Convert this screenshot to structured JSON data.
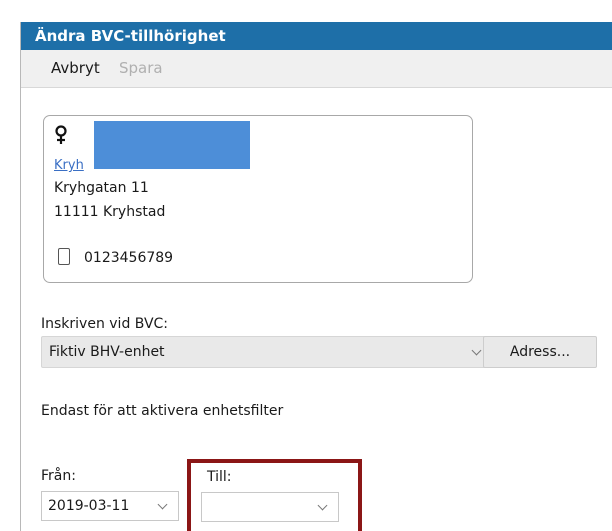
{
  "window": {
    "title": "Ändra BVC-tillhörighet"
  },
  "toolbar": {
    "cancel_label": "Avbryt",
    "save_label": "Spara"
  },
  "patient_card": {
    "link_text": "Kryh",
    "street": "Kryhgatan 11",
    "city": "11111 Kryhstad",
    "phone": "0123456789",
    "gender_icon": "female-icon",
    "phone_icon": "mobile-phone-icon"
  },
  "bvc": {
    "label": "Inskriven vid BVC:",
    "selected": "Fiktiv BHV-enhet",
    "address_button": "Adress..."
  },
  "filter_note": "Endast för att aktivera enhetsfilter",
  "dates": {
    "from_label": "Från:",
    "from_value": "2019-03-11",
    "to_label": "Till:",
    "to_value": ""
  },
  "colors": {
    "titlebar": "#1e6fa8",
    "highlight": "#8b1616",
    "redaction": "#4d8ed8",
    "link": "#3a6fc4"
  }
}
